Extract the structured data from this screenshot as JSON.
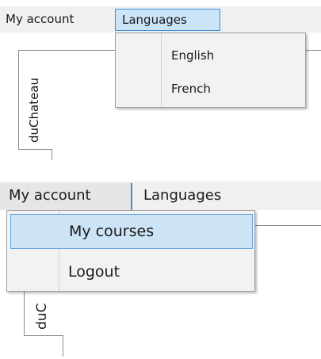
{
  "top": {
    "menubar": [
      "My account",
      "Languages"
    ],
    "submenu": [
      "English",
      "French"
    ],
    "tab": "duChateau"
  },
  "bottom": {
    "menubar": [
      "My account",
      "Languages"
    ],
    "submenu": [
      "My courses",
      "Logout"
    ],
    "tab": "duC"
  },
  "colors": {
    "menubar_bg": "#f0f0f0",
    "selected_bg": "#cce4f7",
    "selected_border": "#3f8fd6",
    "dropdown_bg": "#f2f2f2",
    "dropdown_border": "#a0a0a0"
  }
}
